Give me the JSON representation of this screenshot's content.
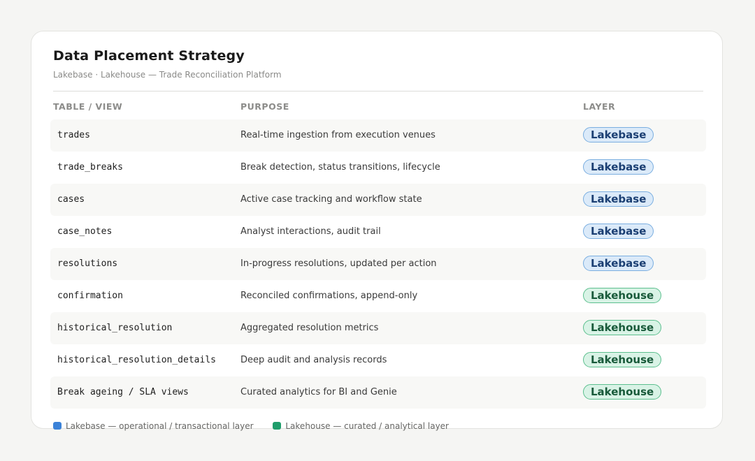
{
  "header": {
    "title": "Data Placement Strategy",
    "subtitle": "Lakebase · Lakehouse  —  Trade Reconciliation Platform"
  },
  "columns": {
    "name": "TABLE / VIEW",
    "purpose": "PURPOSE",
    "layer": "LAYER"
  },
  "rows": [
    {
      "name": "trades",
      "purpose": "Real-time ingestion from execution venues",
      "layer": "Lakebase"
    },
    {
      "name": "trade_breaks",
      "purpose": "Break detection, status transitions, lifecycle",
      "layer": "Lakebase"
    },
    {
      "name": "cases",
      "purpose": "Active case tracking and workflow state",
      "layer": "Lakebase"
    },
    {
      "name": "case_notes",
      "purpose": "Analyst interactions, audit trail",
      "layer": "Lakebase"
    },
    {
      "name": "resolutions",
      "purpose": "In-progress resolutions, updated per action",
      "layer": "Lakebase"
    },
    {
      "name": "confirmation",
      "purpose": "Reconciled confirmations, append-only",
      "layer": "Lakehouse"
    },
    {
      "name": "historical_resolution",
      "purpose": "Aggregated resolution metrics",
      "layer": "Lakehouse"
    },
    {
      "name": "historical_resolution_details",
      "purpose": "Deep audit and analysis records",
      "layer": "Lakehouse"
    },
    {
      "name": "Break ageing / SLA views",
      "purpose": "Curated analytics for BI and Genie",
      "layer": "Lakehouse"
    }
  ],
  "legend": [
    {
      "label": "Lakebase  —  operational / transactional layer",
      "color": "#3b82d8"
    },
    {
      "label": "Lakehouse  —  curated / analytical layer",
      "color": "#1f9d6b"
    }
  ]
}
